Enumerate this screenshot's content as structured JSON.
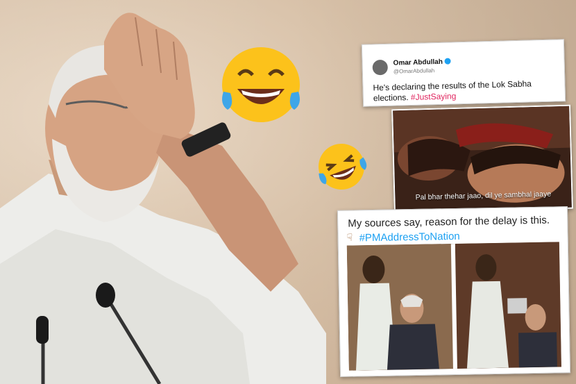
{
  "tweet": {
    "name": "Omar Abdullah",
    "handle": "@OmarAbdullah",
    "text": "He's declaring the results of the Lok Sabha elections. ",
    "hashtag": "#JustSaying"
  },
  "movie_meme": {
    "caption": "Pal bhar thehar jaao,  dil ye sambhal jaaye"
  },
  "photo_meme": {
    "line1": "My sources say, reason for the delay is this.",
    "icon": "pointing-down-icon",
    "hashtag": "#PMAddressToNation"
  },
  "emojis": [
    "tears-of-joy-icon",
    "rolling-laughing-icon"
  ],
  "colors": {
    "hashtag_red": "#e0245e",
    "hashtag_blue": "#1da1f2",
    "verified": "#1da1f2"
  }
}
